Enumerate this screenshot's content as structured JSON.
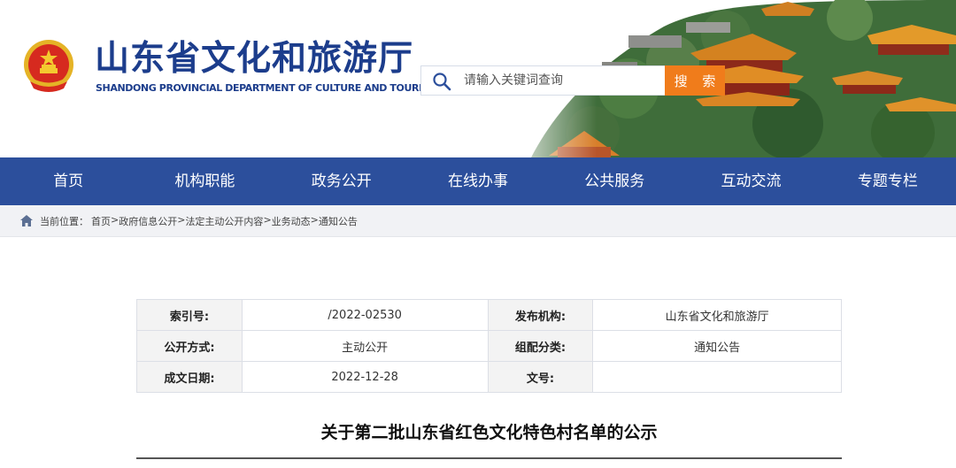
{
  "header": {
    "title": "山东省文化和旅游厅",
    "subtitle": "SHANDONG PROVINCIAL DEPARTMENT OF CULTURE AND TOURISM",
    "emblem_icon": "national-emblem-icon",
    "search": {
      "placeholder": "请输入关键词查询",
      "value": "",
      "button_label": "搜 索",
      "button_color": "#f07c1b"
    }
  },
  "nav": {
    "background": "#2c4f9c",
    "items": [
      {
        "label": "首页"
      },
      {
        "label": "机构职能"
      },
      {
        "label": "政务公开"
      },
      {
        "label": "在线办事"
      },
      {
        "label": "公共服务"
      },
      {
        "label": "互动交流"
      },
      {
        "label": "专题专栏"
      }
    ]
  },
  "breadcrumb": {
    "label": "当前位置：",
    "items": [
      "首页",
      "政府信息公开",
      "法定主动公开内容",
      "业务动态",
      "通知公告"
    ],
    "separator": ">"
  },
  "info": {
    "index_label": "索引号:",
    "index_value": "/2022-02530",
    "publisher_label": "发布机构:",
    "publisher_value": "山东省文化和旅游厅",
    "method_label": "公开方式:",
    "method_value": "主动公开",
    "category_label": "组配分类:",
    "category_value": "通知公告",
    "date_label": "成文日期:",
    "date_value": "2022-12-28",
    "docno_label": "文号:",
    "docno_value": ""
  },
  "article": {
    "title": "关于第二批山东省红色文化特色村名单的公示"
  }
}
